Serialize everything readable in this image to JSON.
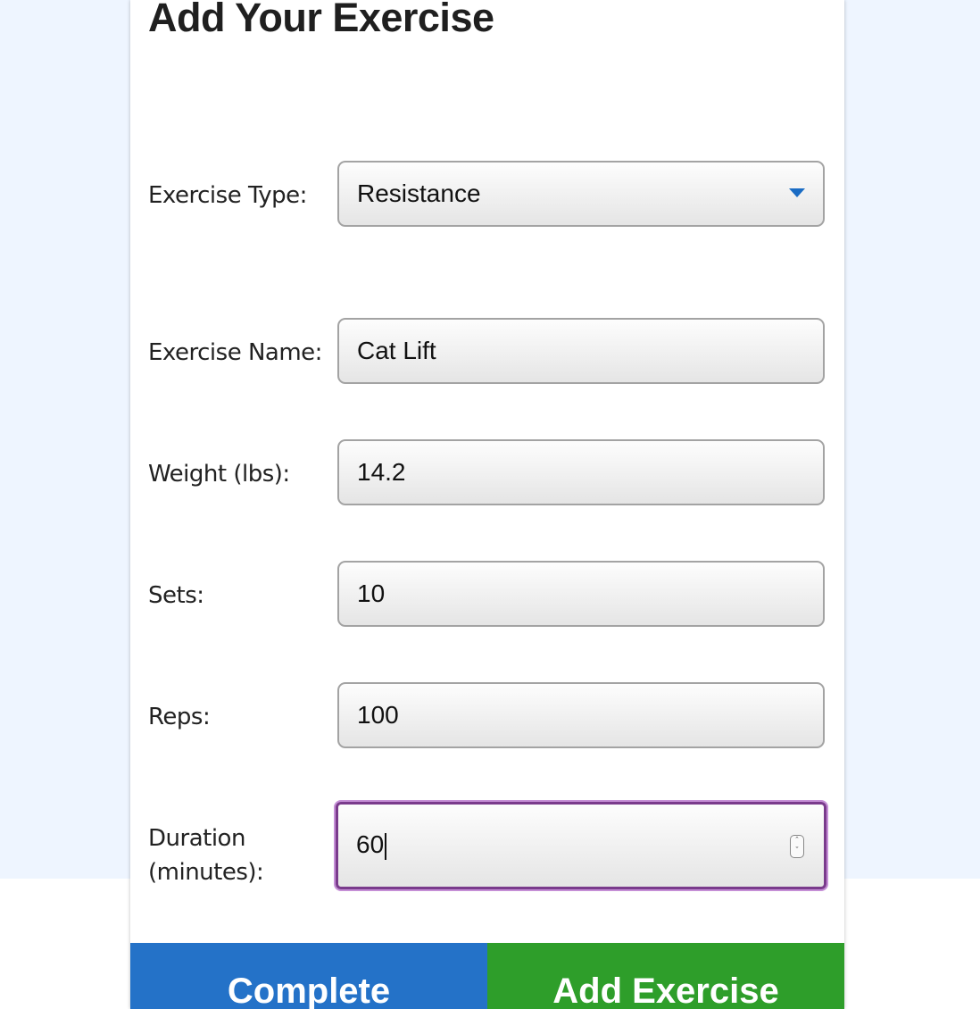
{
  "title": "Add Your Exercise",
  "form": {
    "exercise_type": {
      "label": "Exercise Type:",
      "value": "Resistance"
    },
    "exercise_name": {
      "label": "Exercise Name:",
      "value": "Cat Lift"
    },
    "weight": {
      "label": "Weight (lbs):",
      "value": "14.2"
    },
    "sets": {
      "label": "Sets:",
      "value": "10"
    },
    "reps": {
      "label": "Reps:",
      "value": "100"
    },
    "duration": {
      "label_line1": "Duration",
      "label_line2": "(minutes):",
      "value": "60"
    }
  },
  "buttons": {
    "complete": "Complete",
    "add_exercise": "Add Exercise"
  },
  "icons": {
    "select_arrow": "chevron-down-icon",
    "number_spinner": "spinner-icon"
  },
  "colors": {
    "complete_button": "#2472c8",
    "add_button": "#2e9e2a",
    "focus_ring": "#7a3b8c",
    "page_background": "#eef5ff"
  }
}
